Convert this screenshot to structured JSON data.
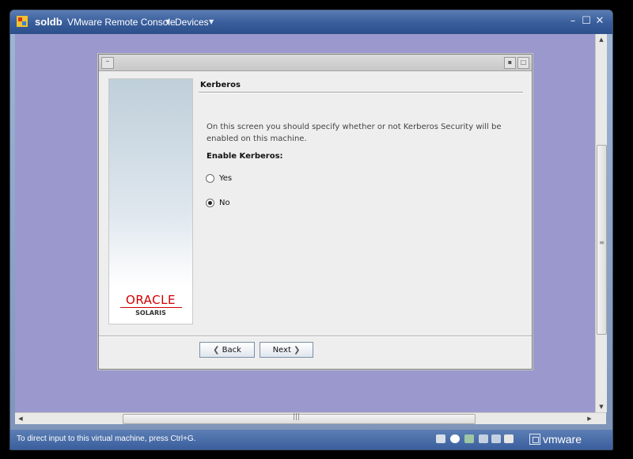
{
  "window": {
    "host": "soldb",
    "app": "VMware Remote Console",
    "devices": "Devices",
    "minimize": "–",
    "maximize": "☐",
    "close": "✕"
  },
  "dialog": {
    "header": "Kerberos",
    "description": "On this screen you should specify whether or not Kerberos Security will be enabled on this machine.",
    "enable_label": "Enable Kerberos:",
    "options": [
      {
        "label": "Yes",
        "checked": false
      },
      {
        "label": "No",
        "checked": true
      }
    ],
    "back_label": "Back",
    "next_label": "Next"
  },
  "branding": {
    "oracle": "ORACLE",
    "solaris": "SOLARIS",
    "oracle_color": "#d20000"
  },
  "statusbar": {
    "message": "To direct input to this virtual machine, press Ctrl+G.",
    "vmware": "vmware"
  },
  "icons": [
    "app-icon",
    "caret-down-icon",
    "minimize-icon",
    "maximize-icon",
    "close-icon",
    "dialog-menu-icon",
    "chevron-left-icon",
    "chevron-right-icon",
    "network-icon",
    "cd-icon",
    "usb-icon",
    "disk-icon",
    "floppy-icon",
    "vmware-logo-icon"
  ]
}
